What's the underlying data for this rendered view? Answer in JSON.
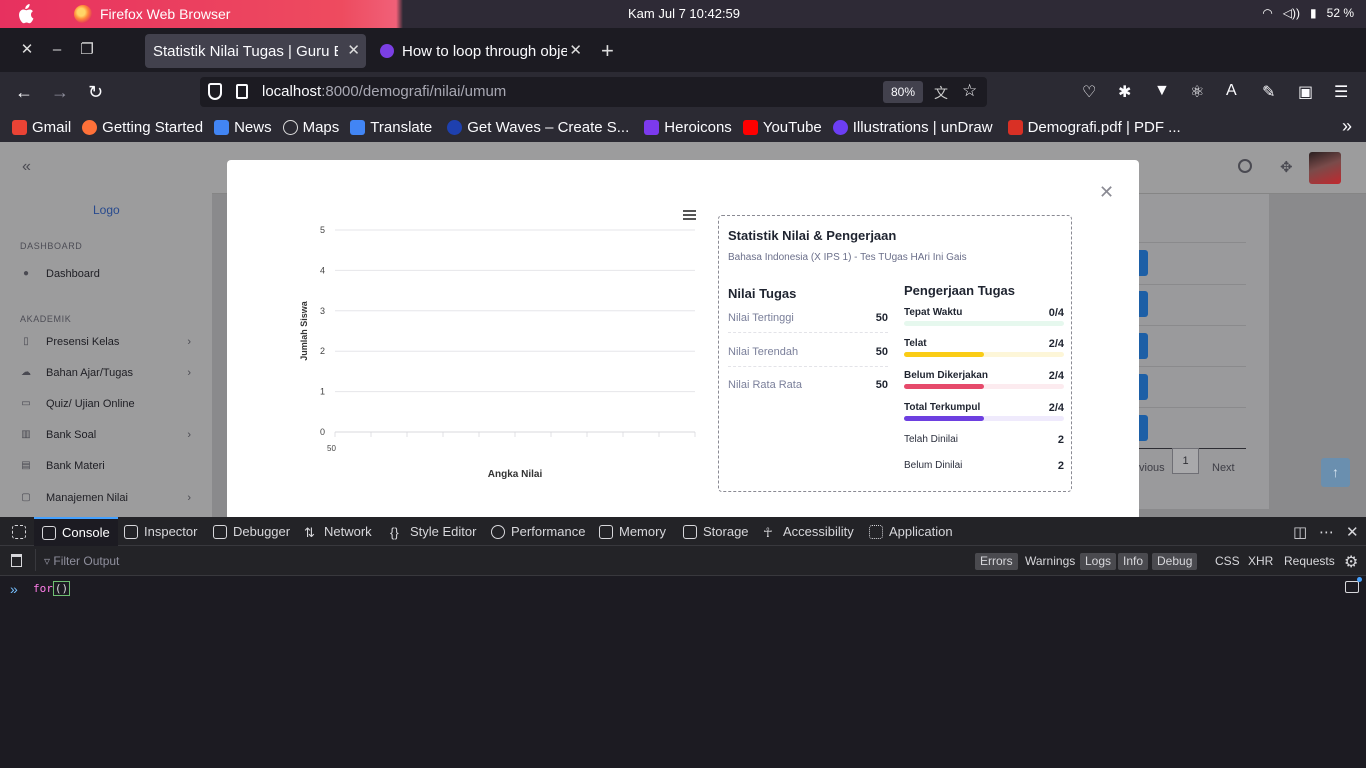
{
  "os": {
    "app_name": "Firefox Web Browser",
    "clock": "Kam Jul 7  10:42:59",
    "battery": "52 %"
  },
  "tabs": [
    {
      "title": "Statistik Nilai Tugas | Guru Ed",
      "active": true
    },
    {
      "title": "How to loop through obje",
      "active": false
    }
  ],
  "nav": {
    "url_host": "localhost",
    "url_rest": ":8000/demografi/nilai/umum",
    "zoom": "80%"
  },
  "bookmarks": [
    {
      "label": "Gmail",
      "color": "#ea4335"
    },
    {
      "label": "Getting Started",
      "color": "#ff7139"
    },
    {
      "label": "News",
      "color": "#4285f4"
    },
    {
      "label": "Maps",
      "color": "#bbbbbb"
    },
    {
      "label": "Translate",
      "color": "#4285f4"
    },
    {
      "label": "Get Waves – Create S...",
      "color": "#1e40af"
    },
    {
      "label": "Heroicons",
      "color": "#7c3aed"
    },
    {
      "label": "YouTube",
      "color": "#ff0000"
    },
    {
      "label": "Illustrations | unDraw",
      "color": "#6c3ef4"
    },
    {
      "label": "Demografi.pdf | PDF ...",
      "color": "#d93025"
    }
  ],
  "sidebar": {
    "logo": "Logo",
    "section_dashboard": "DASHBOARD",
    "section_akademik": "AKADEMIK",
    "items": [
      {
        "label": "Dashboard",
        "chevron": false
      },
      {
        "label": "Presensi Kelas",
        "chevron": true
      },
      {
        "label": "Bahan Ajar/Tugas",
        "chevron": true
      },
      {
        "label": "Quiz/ Ujian Online",
        "chevron": false
      },
      {
        "label": "Bank Soal",
        "chevron": true
      },
      {
        "label": "Bank Materi",
        "chevron": false
      },
      {
        "label": "Manajemen Nilai",
        "chevron": true
      }
    ]
  },
  "pagination": {
    "previous": "vious",
    "current": "1",
    "next": "Next"
  },
  "chart_data": {
    "type": "bar",
    "title": "",
    "xlabel": "Angka Nilai",
    "ylabel": "Jumlah Siswa",
    "categories": [
      "50"
    ],
    "values": [
      0
    ],
    "y_ticks": [
      "0",
      "1",
      "2",
      "3",
      "4",
      "5"
    ],
    "ylim": [
      0,
      5
    ],
    "grid": true
  },
  "stats": {
    "title": "Statistik Nilai & Pengerjaan",
    "subtitle": "Bahasa Indonesia (X IPS 1) - Tes TUgas HAri Ini Gais",
    "nilai_heading": "Nilai Tugas",
    "nilai": [
      {
        "label": "Nilai Tertinggi",
        "value": "50"
      },
      {
        "label": "Nilai Terendah",
        "value": "50"
      },
      {
        "label": "Nilai Rata Rata",
        "value": "50"
      }
    ],
    "pengerjaan_heading": "Pengerjaan Tugas",
    "pengerjaan": [
      {
        "label": "Tepat Waktu",
        "value": "0/4",
        "fraction": 0,
        "color": "#22c55e",
        "track": "#e6f8ee"
      },
      {
        "label": "Telat",
        "value": "2/4",
        "fraction": 0.5,
        "color": "#facc15",
        "track": "#fdf6d8"
      },
      {
        "label": "Belum Dikerjakan",
        "value": "2/4",
        "fraction": 0.5,
        "color": "#e64a6b",
        "track": "#fcebef"
      },
      {
        "label": "Total Terkumpul",
        "value": "2/4",
        "fraction": 0.5,
        "color": "#6d3fe0",
        "track": "#efeafc"
      }
    ],
    "penilaian": [
      {
        "label": "Telah Dinilai",
        "value": "2"
      },
      {
        "label": "Belum Dinilai",
        "value": "2"
      }
    ]
  },
  "devtools": {
    "tabs": [
      "Console",
      "Inspector",
      "Debugger",
      "Network",
      "Style Editor",
      "Performance",
      "Memory",
      "Storage",
      "Accessibility",
      "Application"
    ],
    "filter_placeholder": "Filter Output",
    "filters": [
      {
        "label": "Errors",
        "on": true
      },
      {
        "label": "Warnings",
        "on": false
      },
      {
        "label": "Logs",
        "on": true
      },
      {
        "label": "Info",
        "on": true
      },
      {
        "label": "Debug",
        "on": true
      },
      {
        "label": "CSS",
        "on": false
      },
      {
        "label": "XHR",
        "on": false
      },
      {
        "label": "Requests",
        "on": false
      }
    ],
    "command_keyword": "for",
    "command_paren": "()"
  }
}
